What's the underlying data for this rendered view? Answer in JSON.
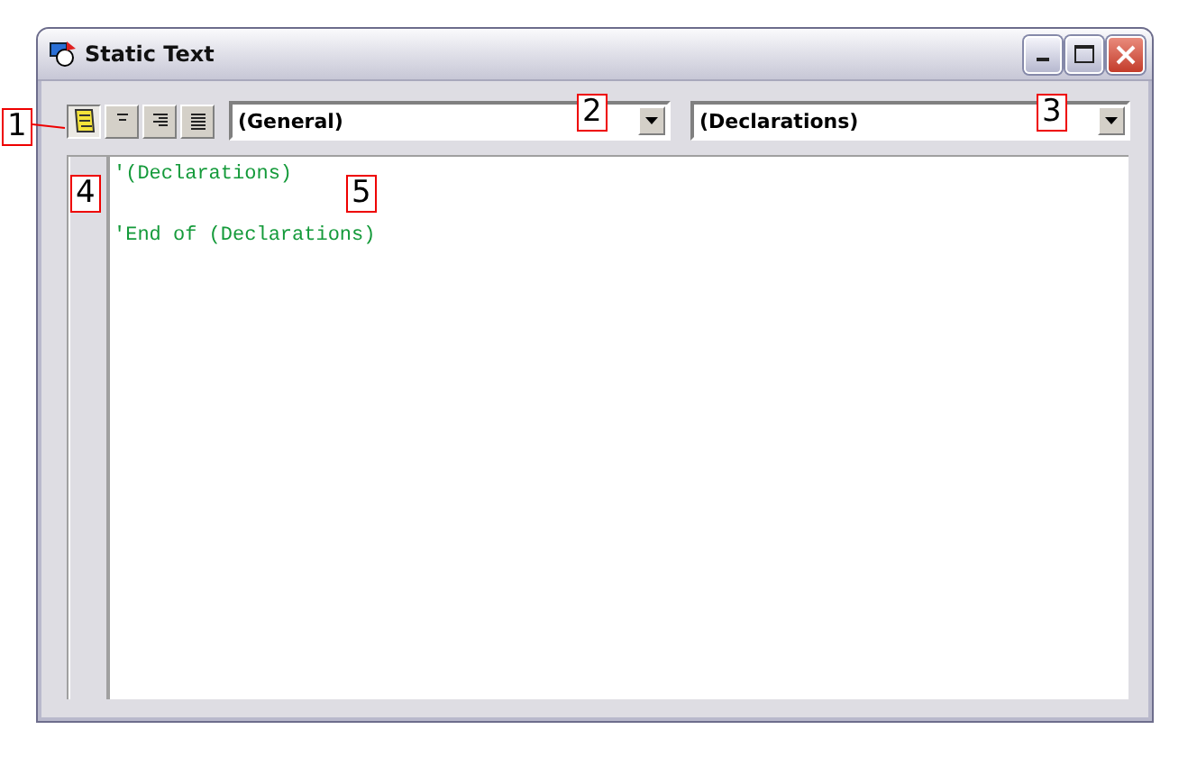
{
  "window": {
    "title": "Static Text"
  },
  "toolbar": {
    "buttons": [
      {
        "kind": "script",
        "selected": true
      },
      {
        "kind": "align-top",
        "selected": false
      },
      {
        "kind": "align-right",
        "selected": false
      },
      {
        "kind": "align-full",
        "selected": false
      }
    ]
  },
  "object_combo": {
    "value": "(General)"
  },
  "procedure_combo": {
    "value": "(Declarations)"
  },
  "code_lines": [
    {
      "text": "'(Declarations)",
      "blank_line_after": true
    },
    {
      "text": "'End of (Declarations)",
      "blank_line_after": false
    }
  ],
  "callouts": [
    {
      "label": "1",
      "kind": "toolbar"
    },
    {
      "label": "2",
      "kind": "object"
    },
    {
      "label": "3",
      "kind": "procedure"
    },
    {
      "label": "4",
      "kind": "gutter"
    },
    {
      "label": "5",
      "kind": "code"
    }
  ]
}
